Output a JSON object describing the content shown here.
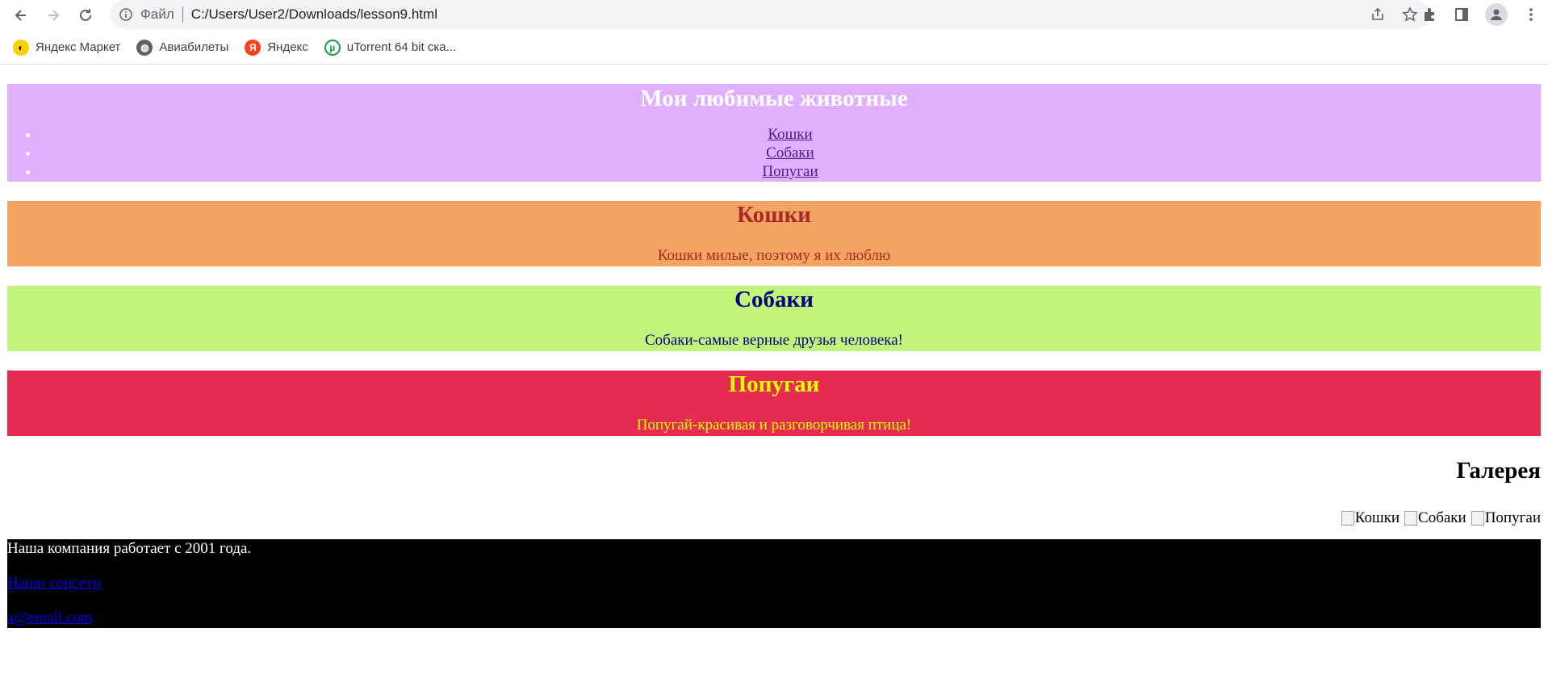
{
  "browser": {
    "scheme_label": "Файл",
    "url": "C:/Users/User2/Downloads/lesson9.html",
    "bookmarks": [
      {
        "label": "Яндекс Маркет",
        "icon": "yandex-market-icon",
        "color": "#fbd200"
      },
      {
        "label": "Авиабилеты",
        "icon": "globe-icon",
        "color": "#5f6368"
      },
      {
        "label": "Яндекс",
        "icon": "yandex-icon",
        "color": "#fc3f1d"
      },
      {
        "label": "uTorrent 64 bit ска...",
        "icon": "utorrent-icon",
        "color": "#1a9e4b"
      }
    ]
  },
  "header": {
    "title": "Мои любимые животные",
    "nav": [
      "Кошки",
      "Собаки",
      "Попугаи"
    ],
    "bg_color": "#e0b0ff"
  },
  "sections": [
    {
      "title": "Кошки",
      "text": "Кошки милые, поэтому я их люблю",
      "bg_color": "#f4a460",
      "text_color": "#a52a2a"
    },
    {
      "title": "Собаки",
      "text": "Собаки-самые верные друзья человека!",
      "bg_color": "#c1f57a",
      "text_color": "#000080"
    },
    {
      "title": "Попугаи",
      "text": "Попугай-красивая и разговорчивая птица!",
      "bg_color": "#e52b50",
      "text_color": "#dfff00"
    }
  ],
  "gallery": {
    "title": "Галерея",
    "images_alt": [
      "Кошки",
      "Собаки",
      "Попугаи"
    ]
  },
  "footer": {
    "text": "Наша компания работает с 2001 года.",
    "social_link": "Наши соцсети",
    "email_link": "a@email.com"
  }
}
